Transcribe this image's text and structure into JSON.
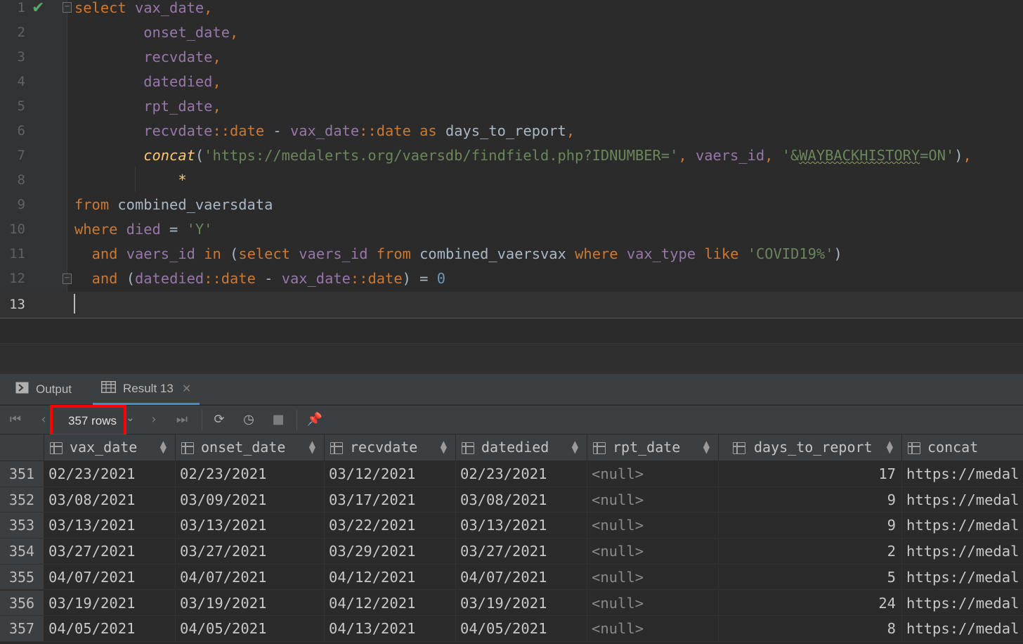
{
  "editor": {
    "lines": [
      {
        "n": "1"
      },
      {
        "n": "2"
      },
      {
        "n": "3"
      },
      {
        "n": "4"
      },
      {
        "n": "5"
      },
      {
        "n": "6"
      },
      {
        "n": "7"
      },
      {
        "n": "8"
      },
      {
        "n": "9"
      },
      {
        "n": "10"
      },
      {
        "n": "11"
      },
      {
        "n": "12"
      },
      {
        "n": "13"
      }
    ],
    "tokens": {
      "l1_select": "select",
      "l1_col": "vax_date",
      "l2_col": "onset_date",
      "l3_col": "recvdate",
      "l4_col": "datedied",
      "l5_col": "rpt_date",
      "l6_col1": "recvdate",
      "l6_op1": "::",
      "l6_type1": "date",
      "l6_minus": " - ",
      "l6_col2": "vax_date",
      "l6_op2": "::",
      "l6_type2": "date",
      "l6_as": "as",
      "l6_alias": "days_to_report",
      "l7_fn": "concat",
      "l7_str1": "'https://medalerts.org/vaersdb/findfield.php?IDNUMBER='",
      "l7_col": "vaers_id",
      "l7_str2_a": "'&",
      "l7_str2_b": "WAYBACKHISTORY",
      "l7_str2_c": "=ON'",
      "l8_star": "*",
      "l9_from": "from",
      "l9_table": "combined_vaersdata",
      "l10_where": "where",
      "l10_col": "died",
      "l10_eq": " = ",
      "l10_str": "'Y'",
      "l11_and": "and",
      "l11_col": "vaers_id",
      "l11_in": "in",
      "l11_select": "select",
      "l11_col2": "vaers_id",
      "l11_from": "from",
      "l11_table": "combined_vaersvax",
      "l11_where": "where",
      "l11_col3": "vax_type",
      "l11_like": "like",
      "l11_str": "'COVID19%'",
      "l12_and": "and",
      "l12_col1": "datedied",
      "l12_type1": "date",
      "l12_col2": "vax_date",
      "l12_type2": "date",
      "l12_num": "0"
    }
  },
  "tabs": [
    {
      "label": "Output",
      "icon": "console-icon"
    },
    {
      "label": "Result 13",
      "icon": "table-icon"
    }
  ],
  "toolbar": {
    "rows_label": "357 rows",
    "buttons": [
      "first-page-icon",
      "prev-page-icon",
      "next-page-icon",
      "last-page-icon",
      "refresh-icon",
      "history-icon",
      "stop-icon",
      "pin-icon"
    ]
  },
  "grid": {
    "columns": [
      "vax_date",
      "onset_date",
      "recvdate",
      "datedied",
      "rpt_date",
      "days_to_report",
      "concat"
    ],
    "rows": [
      {
        "n": "351",
        "cells": [
          "02/23/2021",
          "02/23/2021",
          "03/12/2021",
          "02/23/2021",
          "<null>",
          "17",
          "https://medal"
        ]
      },
      {
        "n": "352",
        "cells": [
          "03/08/2021",
          "03/09/2021",
          "03/17/2021",
          "03/08/2021",
          "<null>",
          "9",
          "https://medal"
        ]
      },
      {
        "n": "353",
        "cells": [
          "03/13/2021",
          "03/13/2021",
          "03/22/2021",
          "03/13/2021",
          "<null>",
          "9",
          "https://medal"
        ]
      },
      {
        "n": "354",
        "cells": [
          "03/27/2021",
          "03/27/2021",
          "03/29/2021",
          "03/27/2021",
          "<null>",
          "2",
          "https://medal"
        ]
      },
      {
        "n": "355",
        "cells": [
          "04/07/2021",
          "04/07/2021",
          "04/12/2021",
          "04/07/2021",
          "<null>",
          "5",
          "https://medal"
        ]
      },
      {
        "n": "356",
        "cells": [
          "03/19/2021",
          "03/19/2021",
          "04/12/2021",
          "03/19/2021",
          "<null>",
          "24",
          "https://medal"
        ]
      },
      {
        "n": "357",
        "cells": [
          "04/05/2021",
          "04/05/2021",
          "04/13/2021",
          "04/05/2021",
          "<null>",
          "8",
          "https://medal"
        ]
      }
    ]
  }
}
